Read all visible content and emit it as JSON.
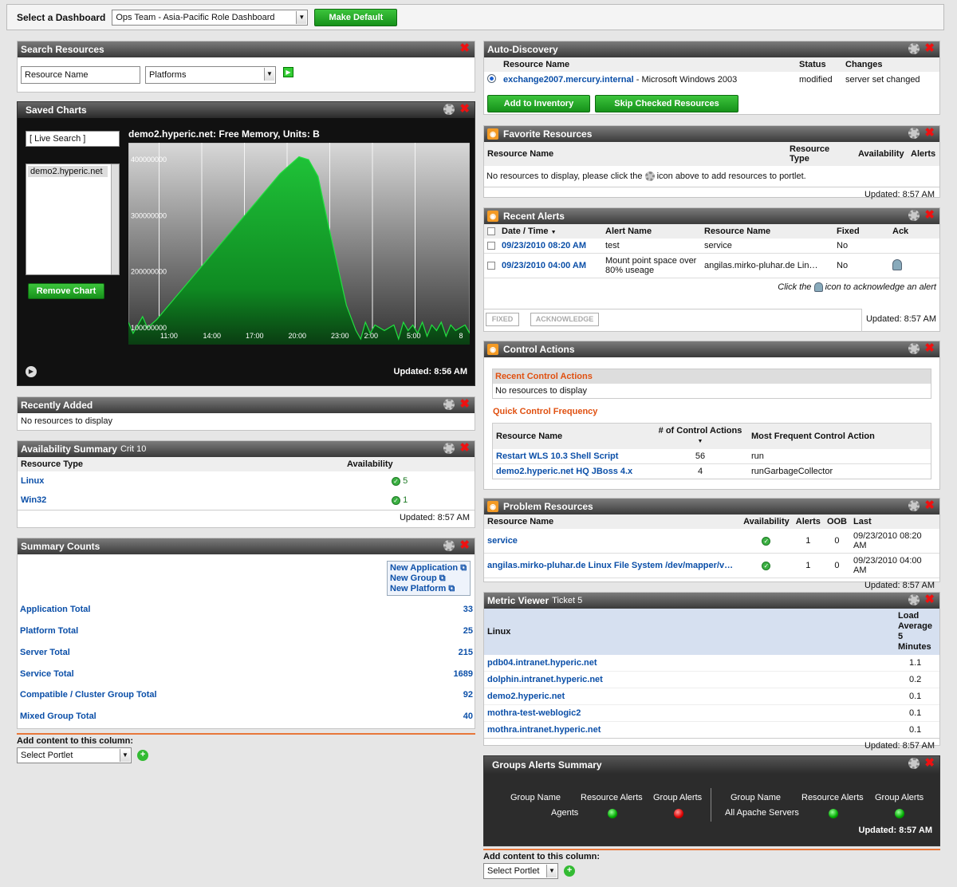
{
  "topbar": {
    "label": "Select a Dashboard",
    "dashboard": "Ops Team - Asia-Pacific Role Dashboard",
    "make_default": "Make Default"
  },
  "search": {
    "title": "Search Resources",
    "name_value": "Resource Name",
    "type_value": "Platforms"
  },
  "saved_charts": {
    "title": "Saved Charts",
    "live_search": "[ Live Search ]",
    "list_item": "demo2.hyperic.net",
    "remove": "Remove Chart",
    "updated": "Updated: 8:56 AM"
  },
  "chart_data": {
    "type": "area",
    "title": "demo2.hyperic.net: Free Memory, Units: B",
    "x_ticks": [
      "11:00",
      "14:00",
      "17:00",
      "20:00",
      "23:00",
      "2:00",
      "5:00",
      "8"
    ],
    "y_ticks": [
      "400000000",
      "300000000",
      "200000000",
      "100000000"
    ],
    "ylim": [
      60000000,
      420000000
    ],
    "x": [
      0,
      0.5,
      1,
      1.5,
      2,
      3,
      4,
      5,
      6,
      7,
      8,
      9,
      10,
      11,
      12,
      13,
      14,
      15,
      16,
      17,
      18,
      19,
      20,
      21,
      22,
      23,
      24,
      24.5,
      25,
      25.5,
      26,
      27,
      28,
      28.5,
      29,
      29.5,
      30,
      30.5,
      31,
      31.5,
      32,
      32.5,
      33,
      33.5,
      34,
      34.5,
      35,
      35.5,
      36
    ],
    "values": [
      100000000,
      80000000,
      95000000,
      110000000,
      90000000,
      105000000,
      125000000,
      145000000,
      165000000,
      185000000,
      205000000,
      225000000,
      245000000,
      265000000,
      285000000,
      305000000,
      325000000,
      345000000,
      365000000,
      380000000,
      395000000,
      390000000,
      360000000,
      280000000,
      205000000,
      130000000,
      85000000,
      70000000,
      100000000,
      80000000,
      95000000,
      85000000,
      95000000,
      70000000,
      100000000,
      85000000,
      95000000,
      80000000,
      100000000,
      75000000,
      95000000,
      85000000,
      100000000,
      75000000,
      95000000,
      85000000,
      90000000,
      95000000,
      80000000
    ]
  },
  "recently_added": {
    "title": "Recently Added",
    "empty": "No resources to display"
  },
  "availability": {
    "title": "Availability Summary",
    "sub": "Crit 10",
    "col1": "Resource Type",
    "col2": "Availability",
    "rows": [
      {
        "name": "Linux",
        "count": "5"
      },
      {
        "name": "Win32",
        "count": "1"
      }
    ],
    "updated": "Updated: 8:57 AM"
  },
  "summary": {
    "title": "Summary Counts",
    "new_app": "New Application",
    "new_group": "New Group",
    "new_platform": "New Platform",
    "rows": [
      {
        "label": "Application Total",
        "value": "33"
      },
      {
        "label": "Platform Total",
        "value": "25"
      },
      {
        "label": "Server Total",
        "value": "215"
      },
      {
        "label": "Service Total",
        "value": "1689"
      },
      {
        "label": "Compatible / Cluster Group Total",
        "value": "92"
      },
      {
        "label": "Mixed Group Total",
        "value": "40"
      }
    ]
  },
  "left_add": {
    "label": "Add content to this column:",
    "select": "Select Portlet"
  },
  "autodisc": {
    "title": "Auto-Discovery",
    "h_name": "Resource Name",
    "h_status": "Status",
    "h_changes": "Changes",
    "link": "exchange2007.mercury.internal",
    "os": " - Microsoft Windows 2003",
    "status": "modified",
    "changes": "server set changed",
    "add": "Add to Inventory",
    "skip": "Skip Checked Resources"
  },
  "favorites": {
    "title": "Favorite Resources",
    "h_name": "Resource Name",
    "h_type": "Resource Type",
    "h_avail": "Availability",
    "h_alerts": "Alerts",
    "msg1": "No resources to display, please click the",
    "msg2": "icon above to add resources to portlet.",
    "updated": "Updated: 8:57 AM"
  },
  "alerts": {
    "title": "Recent Alerts",
    "h_date": "Date / Time",
    "h_name": "Alert Name",
    "h_res": "Resource Name",
    "h_fixed": "Fixed",
    "h_ack": "Ack",
    "rows": [
      {
        "date": "09/23/2010 08:20 AM",
        "name": "test",
        "res": "service",
        "fixed": "No"
      },
      {
        "date": "09/23/2010 04:00 AM",
        "name": "Mount point space over 80% useage",
        "res": "angilas.mirko-pluhar.de Lin…",
        "fixed": "No"
      }
    ],
    "hint1": "Click the",
    "hint2": "icon to acknowledge an alert",
    "fixed_btn": "FIXED",
    "ack_btn": "ACKNOWLEDGE",
    "updated": "Updated: 8:57 AM"
  },
  "control": {
    "title": "Control Actions",
    "recent": "Recent Control Actions",
    "empty": "No resources to display",
    "quick": "Quick Control Frequency",
    "h_name": "Resource Name",
    "h_count": "# of Control Actions",
    "h_freq": "Most Frequent Control Action",
    "rows": [
      {
        "name": "Restart WLS 10.3 Shell Script",
        "count": "56",
        "action": "run"
      },
      {
        "name": "demo2.hyperic.net HQ JBoss 4.x",
        "count": "4",
        "action": "runGarbageCollector"
      }
    ]
  },
  "problems": {
    "title": "Problem Resources",
    "h_name": "Resource Name",
    "h_avail": "Availability",
    "h_alerts": "Alerts",
    "h_oob": "OOB",
    "h_last": "Last",
    "rows": [
      {
        "name": "service",
        "alerts": "1",
        "oob": "0",
        "last": "09/23/2010 08:20 AM"
      },
      {
        "name": "angilas.mirko-pluhar.de Linux File System /dev/mapper/v…",
        "alerts": "1",
        "oob": "0",
        "last": "09/23/2010 04:00 AM"
      }
    ],
    "updated": "Updated: 8:57 AM"
  },
  "metric": {
    "title": "Metric Viewer",
    "sub": "Ticket 5",
    "h_linux": "Linux",
    "h_load1": "Load",
    "h_load2": "Average",
    "h_load3": "5 Minutes",
    "rows": [
      {
        "host": "pdb04.intranet.hyperic.net",
        "v": "1.1"
      },
      {
        "host": "dolphin.intranet.hyperic.net",
        "v": "0.2"
      },
      {
        "host": "demo2.hyperic.net",
        "v": "0.1"
      },
      {
        "host": "mothra-test-weblogic2",
        "v": "0.1"
      },
      {
        "host": "mothra.intranet.hyperic.net",
        "v": "0.1"
      }
    ],
    "updated": "Updated: 8:57 AM"
  },
  "groups": {
    "title": "Groups Alerts Summary",
    "h_group": "Group Name",
    "h_res": "Resource Alerts",
    "h_grp": "Group Alerts",
    "g1": "Agents",
    "g2": "All Apache Servers",
    "updated": "Updated: 8:57 AM"
  },
  "right_add": {
    "label": "Add content to this column:",
    "select": "Select Portlet"
  }
}
